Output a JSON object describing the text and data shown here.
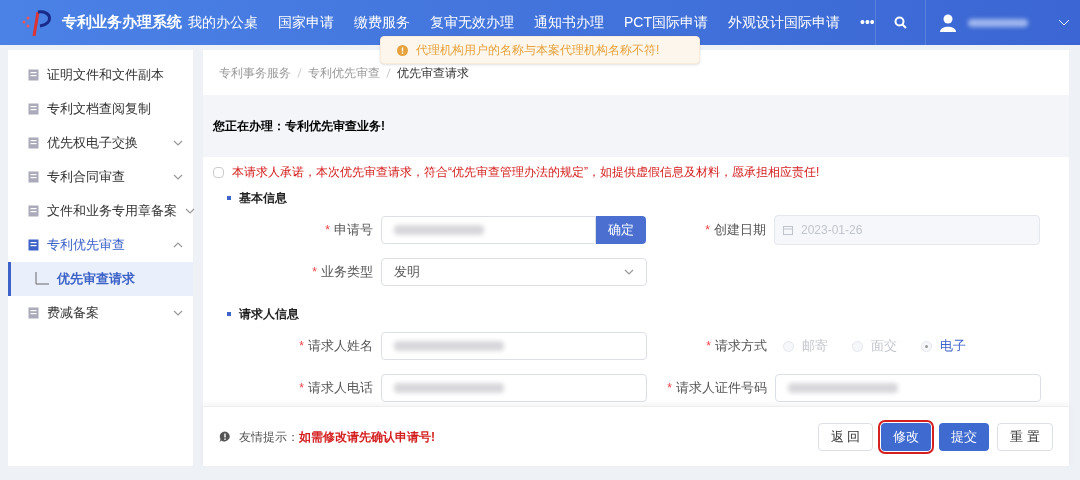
{
  "header": {
    "title": "专利业务办理系统",
    "nav": [
      {
        "label": "我的办公桌"
      },
      {
        "label": "国家申请"
      },
      {
        "label": "缴费服务"
      },
      {
        "label": "复审无效办理"
      },
      {
        "label": "通知书办理"
      },
      {
        "label": "PCT国际申请"
      },
      {
        "label": "外观设计国际申请"
      },
      {
        "label": "•••"
      }
    ]
  },
  "toast": {
    "text": "代理机构用户的名称与本案代理机构名称不符!"
  },
  "sidebar": {
    "items": [
      {
        "label": "证明文件和文件副本",
        "selected": false
      },
      {
        "label": "专利文档查阅复制",
        "selected": false
      },
      {
        "label": "优先权电子交换",
        "expanded": false,
        "selected": false
      },
      {
        "label": "专利合同审查",
        "expanded": false,
        "selected": false
      },
      {
        "label": "文件和业务专用章备案",
        "expanded": false,
        "selected": false
      },
      {
        "label": "专利优先审查",
        "expanded": true,
        "selected": true,
        "children": [
          {
            "label": "优先审查请求",
            "selected": true
          }
        ]
      },
      {
        "label": "费减备案",
        "expanded": false,
        "selected": false
      }
    ]
  },
  "breadcrumb": [
    {
      "label": "专利事务服务"
    },
    {
      "label": "专利优先审查"
    },
    {
      "label": "优先审查请求"
    }
  ],
  "banner": "您正在办理：专利优先审查业务!",
  "pledge": {
    "checked": false,
    "text": "本请求人承诺，本次优先审查请求，符合“优先审查管理办法的规定”，如提供虚假信息及材料，愿承担相应责任!"
  },
  "sections": [
    {
      "title": "基本信息",
      "rows": [
        [
          {
            "label": "申请号",
            "required_mark": "*",
            "kind": "input-button",
            "button": "确定"
          },
          {
            "label": "创建日期",
            "required_mark": "*",
            "kind": "date",
            "value": "2023-01-26"
          }
        ],
        [
          {
            "label": "业务类型",
            "required_mark": "*",
            "kind": "select",
            "value": "发明"
          }
        ]
      ]
    },
    {
      "title": "请求人信息",
      "rows": [
        [
          {
            "label": "请求人姓名",
            "required_mark": "*",
            "kind": "input"
          },
          {
            "label": "请求方式",
            "required_mark": "*",
            "kind": "radio",
            "options": [
              {
                "label": "邮寄",
                "selected": false,
                "disabled": true
              },
              {
                "label": "面交",
                "selected": false,
                "disabled": true
              },
              {
                "label": "电子",
                "selected": true,
                "disabled": true
              }
            ]
          }
        ],
        [
          {
            "label": "请求人电话",
            "required_mark": "*",
            "kind": "input"
          },
          {
            "label": "请求人证件号码",
            "required_mark": "*",
            "kind": "input"
          }
        ]
      ]
    }
  ],
  "footer": {
    "hint_label": "友情提示：",
    "hint": "如需修改请先确认申请号!",
    "buttons": [
      {
        "label": "返 回",
        "kind": "default",
        "highlighted": false
      },
      {
        "label": "修改",
        "kind": "primary",
        "highlighted": true
      },
      {
        "label": "提交",
        "kind": "primary",
        "highlighted": false
      },
      {
        "label": "重 置",
        "kind": "default",
        "highlighted": false
      }
    ]
  }
}
